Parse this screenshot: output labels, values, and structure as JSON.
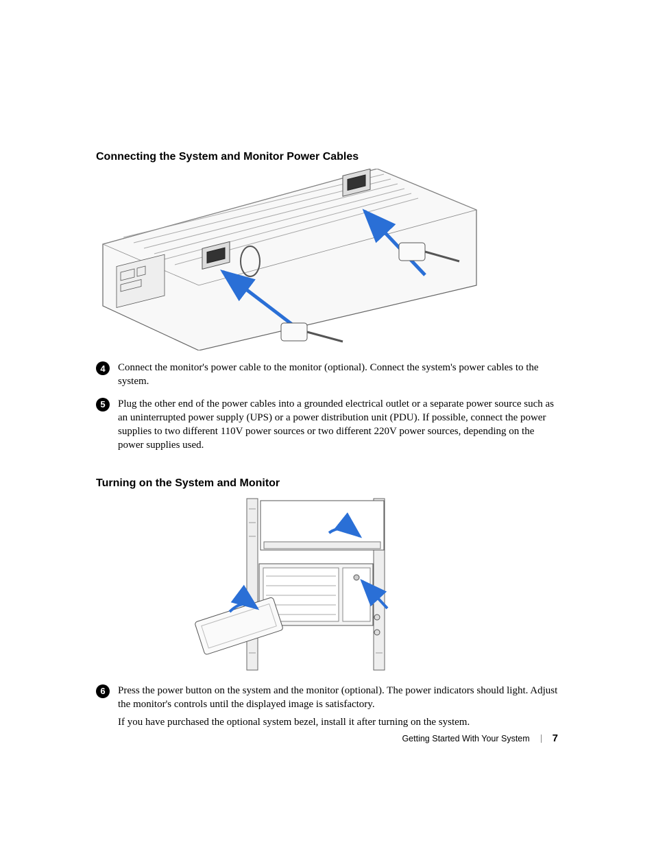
{
  "sections": [
    {
      "heading": "Connecting the System and Monitor Power Cables",
      "figure_alt": "Diagram: rear of rack server showing two power supply inlets with power cables being connected (blue arrows).",
      "steps": [
        {
          "num": "4",
          "paragraphs": [
            "Connect the monitor's power cable to the monitor (optional). Connect the system's power cables to the system."
          ]
        },
        {
          "num": "5",
          "paragraphs": [
            "Plug the other end of the power cables into a grounded electrical outlet or a separate power source such as an uninterrupted power supply (UPS) or a power distribution unit (PDU). If possible, connect the power supplies to two different 110V power sources or two different 220V power sources, depending on the power supplies used."
          ]
        }
      ]
    },
    {
      "heading": "Turning on the System and Monitor",
      "figure_alt": "Diagram: front of rack-mounted server and monitor with arrows pointing to power buttons; bezel shown being attached.",
      "steps": [
        {
          "num": "6",
          "paragraphs": [
            "Press the power button on the system and the monitor (optional). The power indicators should light. Adjust the monitor's controls until the displayed image is satisfactory.",
            "If you have purchased the optional system bezel, install it after turning on the system."
          ]
        }
      ]
    }
  ],
  "footer": {
    "title": "Getting Started With Your System",
    "page": "7"
  }
}
